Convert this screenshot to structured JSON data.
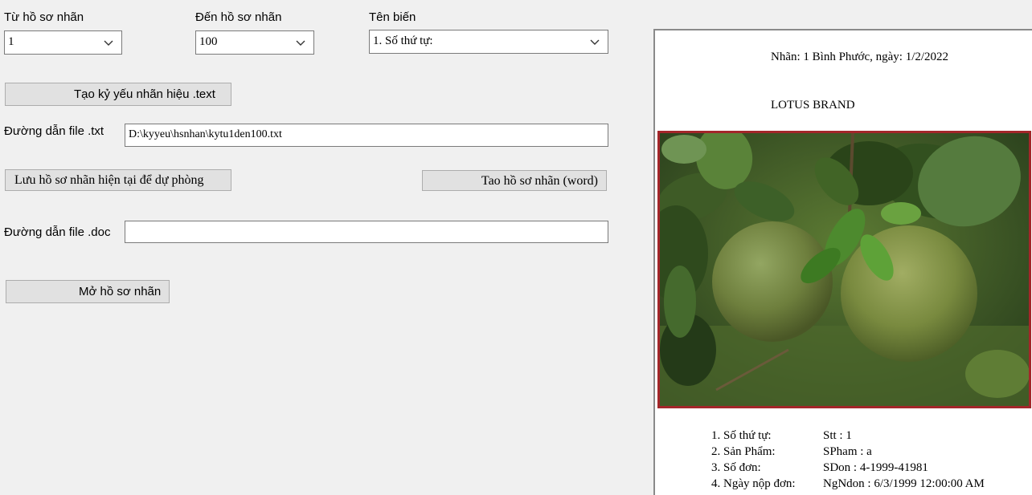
{
  "form": {
    "from_label": "Từ hồ sơ nhãn",
    "from_value": "1",
    "to_label": "Đến hồ sơ nhãn",
    "to_value": "100",
    "var_label": "Tên biến",
    "var_value": "1. Số thứ tự:",
    "create_text_button": "Tạo  kỷ yếu nhãn hiệu .text",
    "txt_path_label": "Đường dẫn file .txt",
    "txt_path_value": "D:\\kyyeu\\hsnhan\\kytu1den100.txt",
    "backup_button": "Lưu  hồ sơ nhãn hiện tại để dự phòng",
    "create_word_button": "Tao hồ sơ nhãn (word)",
    "doc_path_label": "Đường dẫn file .doc",
    "doc_path_value": "",
    "open_button": "Mở hồ sơ nhãn"
  },
  "preview": {
    "header": "Nhãn: 1  Bình Phước, ngày: 1/2/2022",
    "brand": "LOTUS BRAND",
    "info": [
      {
        "key": "1. Số thứ tự:",
        "value": "Stt : 1"
      },
      {
        "key": "2. Sản Phẩm:",
        "value": "SPham : a"
      },
      {
        "key": "3. Số đơn:",
        "value": "SDon : 4-1999-41981"
      },
      {
        "key": "4. Ngày nộp đơn:",
        "value": "NgNdon : 6/3/1999 12:00:00 AM"
      }
    ]
  },
  "colors": {
    "background": "#f0f0f0",
    "photo_border": "#a3262a"
  },
  "icons": [
    "chevron-down-icon",
    "pomelo-photo"
  ]
}
